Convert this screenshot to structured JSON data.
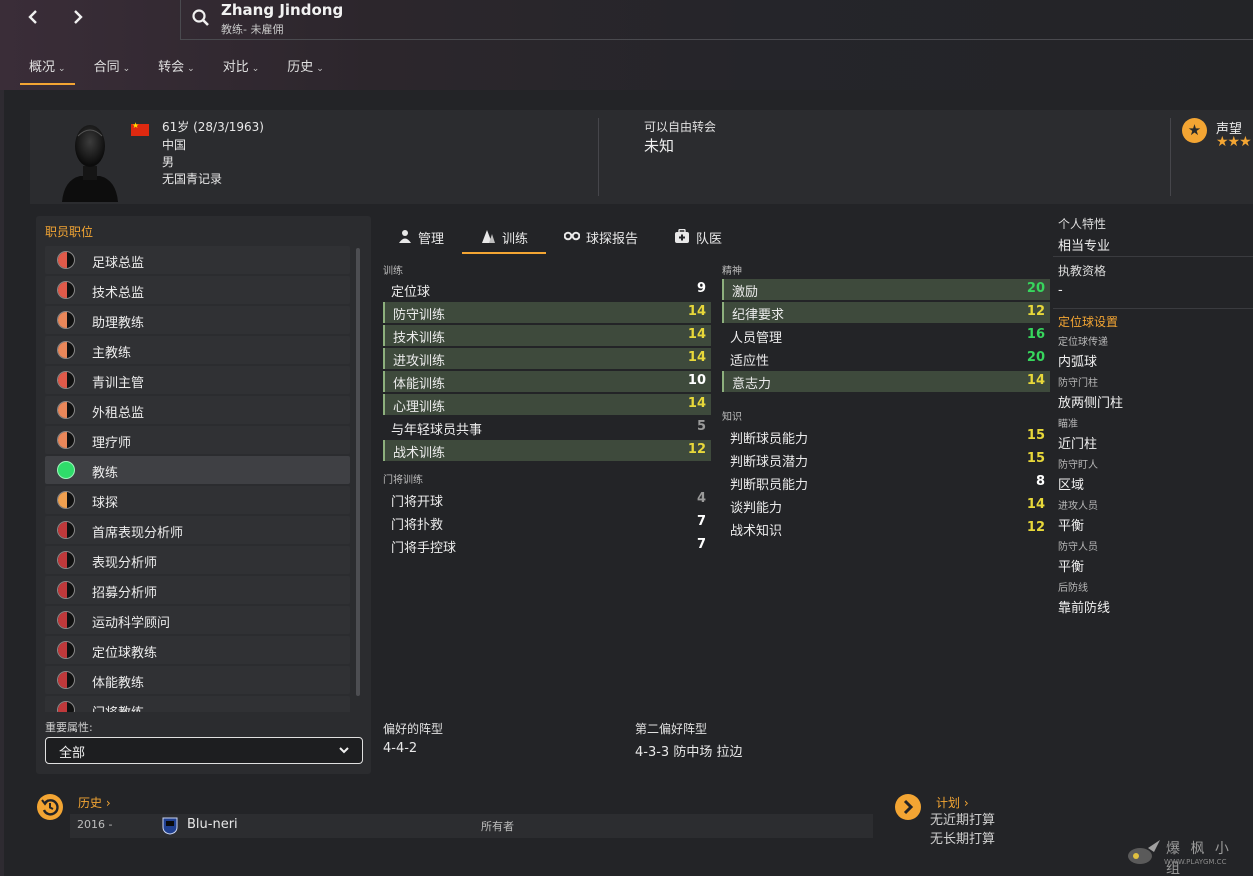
{
  "header": {
    "name": "Zhang Jindong",
    "subtitle": "教练- 未雇佣",
    "tabs": [
      {
        "label": "概况",
        "active": true
      },
      {
        "label": "合同",
        "active": false
      },
      {
        "label": "转会",
        "active": false
      },
      {
        "label": "对比",
        "active": false
      },
      {
        "label": "历史",
        "active": false
      }
    ]
  },
  "profile": {
    "age_dob": "61岁 (28/3/1963)",
    "nationality": "中国",
    "gender": "男",
    "youth_record": "无国青记录",
    "transfer_label": "可以自由转会",
    "transfer_value": "未知",
    "reputation_label": "声望",
    "reputation_stars": "★★★"
  },
  "roles": {
    "title": "职员职位",
    "items": [
      {
        "label": "足球总监",
        "fill": "#e05a4a",
        "full": false
      },
      {
        "label": "技术总监",
        "fill": "#e05a4a",
        "full": false
      },
      {
        "label": "助理教练",
        "fill": "#e9875a",
        "full": false
      },
      {
        "label": "主教练",
        "fill": "#e9875a",
        "full": false
      },
      {
        "label": "青训主管",
        "fill": "#e05a4a",
        "full": false
      },
      {
        "label": "外租总监",
        "fill": "#e9875a",
        "full": false
      },
      {
        "label": "理疗师",
        "fill": "#e9875a",
        "full": false
      },
      {
        "label": "教练",
        "fill": "#2fdc6a",
        "full": true
      },
      {
        "label": "球探",
        "fill": "#f0a050",
        "full": false
      },
      {
        "label": "首席表现分析师",
        "fill": "#c0393b",
        "full": false
      },
      {
        "label": "表现分析师",
        "fill": "#c0393b",
        "full": false
      },
      {
        "label": "招募分析师",
        "fill": "#c0393b",
        "full": false
      },
      {
        "label": "运动科学顾问",
        "fill": "#c0393b",
        "full": false
      },
      {
        "label": "定位球教练",
        "fill": "#c0393b",
        "full": false
      },
      {
        "label": "体能教练",
        "fill": "#c0393b",
        "full": false
      },
      {
        "label": "门将教练",
        "fill": "#c0393b",
        "full": false
      }
    ],
    "key_attr_label": "重要属性:",
    "key_attr_value": "全部"
  },
  "attr_tabs": [
    {
      "label": "管理",
      "active": false
    },
    {
      "label": "训练",
      "active": true
    },
    {
      "label": "球探报告",
      "active": false
    },
    {
      "label": "队医",
      "active": false
    }
  ],
  "training": {
    "title": "训练",
    "items": [
      {
        "name": "定位球",
        "value": "9",
        "hl": false,
        "color": "white"
      },
      {
        "name": "防守训练",
        "value": "14",
        "hl": true,
        "color": "yellow"
      },
      {
        "name": "技术训练",
        "value": "14",
        "hl": true,
        "color": "yellow"
      },
      {
        "name": "进攻训练",
        "value": "14",
        "hl": true,
        "color": "yellow"
      },
      {
        "name": "体能训练",
        "value": "10",
        "hl": true,
        "color": "white"
      },
      {
        "name": "心理训练",
        "value": "14",
        "hl": true,
        "color": "yellow"
      },
      {
        "name": "与年轻球员共事",
        "value": "5",
        "hl": false,
        "color": "gray"
      },
      {
        "name": "战术训练",
        "value": "12",
        "hl": true,
        "color": "yellow"
      }
    ]
  },
  "gk_training": {
    "title": "门将训练",
    "items": [
      {
        "name": "门将开球",
        "value": "4",
        "hl": false,
        "color": "gray"
      },
      {
        "name": "门将扑救",
        "value": "7",
        "hl": false,
        "color": "white"
      },
      {
        "name": "门将手控球",
        "value": "7",
        "hl": false,
        "color": "white"
      }
    ]
  },
  "mental": {
    "title": "精神",
    "items": [
      {
        "name": "激励",
        "value": "20",
        "hl": true,
        "color": "green"
      },
      {
        "name": "纪律要求",
        "value": "12",
        "hl": true,
        "color": "yellow"
      },
      {
        "name": "人员管理",
        "value": "16",
        "hl": false,
        "color": "green"
      },
      {
        "name": "适应性",
        "value": "20",
        "hl": false,
        "color": "green"
      },
      {
        "name": "意志力",
        "value": "14",
        "hl": true,
        "color": "yellow"
      }
    ]
  },
  "knowledge": {
    "title": "知识",
    "items": [
      {
        "name": "判断球员能力",
        "value": "15",
        "hl": false,
        "color": "yellow"
      },
      {
        "name": "判断球员潜力",
        "value": "15",
        "hl": false,
        "color": "yellow"
      },
      {
        "name": "判断职员能力",
        "value": "8",
        "hl": false,
        "color": "white"
      },
      {
        "name": "谈判能力",
        "value": "14",
        "hl": false,
        "color": "yellow"
      },
      {
        "name": "战术知识",
        "value": "12",
        "hl": false,
        "color": "yellow"
      }
    ]
  },
  "formations": {
    "preferred_label": "偏好的阵型",
    "preferred_value": "4-4-2",
    "second_label": "第二偏好阵型",
    "second_value": "4-3-3 防中场 拉边"
  },
  "traits": {
    "personality_label": "个人特性",
    "personality_value": "相当专业",
    "license_label": "执教资格",
    "license_value": "-",
    "setpiece_title": "定位球设置",
    "setpiece_items": [
      {
        "label": "定位球传递",
        "value": "内弧球"
      },
      {
        "label": "防守门柱",
        "value": "放两侧门柱"
      },
      {
        "label": "瞄准",
        "value": "近门柱"
      },
      {
        "label": "防守盯人",
        "value": "区域"
      },
      {
        "label": "进攻人员",
        "value": "平衡"
      },
      {
        "label": "防守人员",
        "value": "平衡"
      },
      {
        "label": "后防线",
        "value": "靠前防线"
      }
    ]
  },
  "history": {
    "title": "历史",
    "year": "2016 -",
    "club": "Blu-neri",
    "role": "所有者"
  },
  "plans": {
    "title": "计划",
    "short": "无近期打算",
    "long": "无长期打算"
  },
  "watermark": {
    "text": "爆 枫 小 组",
    "url": "WWW.PLAYGM.CC"
  },
  "colors": {
    "accent": "#f3a533",
    "highlight_row": "#3e4a3c",
    "value_green": "#37d65d",
    "value_yellow": "#e8d83a"
  }
}
